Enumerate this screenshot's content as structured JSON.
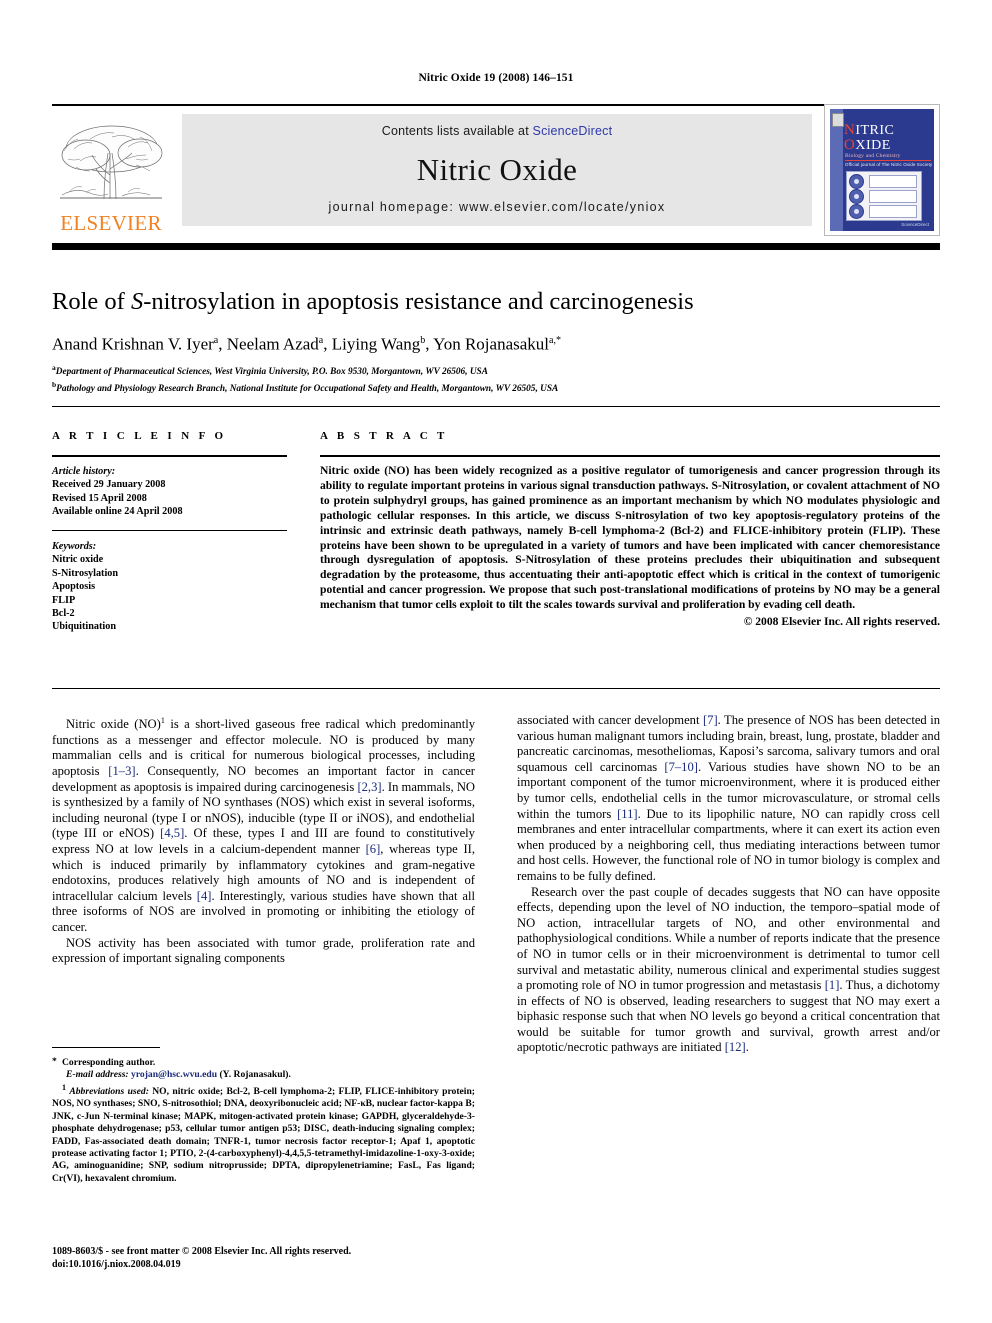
{
  "running_head": "Nitric Oxide 19 (2008) 146–151",
  "masthead": {
    "publisher_logo_text": "ELSEVIER",
    "contents_prefix": "Contents lists available at ",
    "contents_link": "ScienceDirect",
    "journal_name": "Nitric Oxide",
    "homepage": "journal homepage: www.elsevier.com/locate/yniox",
    "cover": {
      "line1": "N",
      "line1_rest": "ITRIC",
      "line2": "O",
      "line2_rest": "XIDE",
      "subtitle": "Biology and Chemistry",
      "society": "Official journal of The Nitric Oxide Society",
      "footer": "ScienceDirect"
    },
    "link_color": "#2d38a8"
  },
  "article": {
    "title_pre": "Role of ",
    "title_italic": "S",
    "title_post": "-nitrosylation in apoptosis resistance and carcinogenesis",
    "authors": [
      {
        "name": "Anand Krishnan V. Iyer",
        "sup": "a"
      },
      {
        "name": "Neelam Azad",
        "sup": "a"
      },
      {
        "name": "Liying Wang",
        "sup": "b"
      },
      {
        "name": "Yon Rojanasakul",
        "sup": "a,*"
      }
    ],
    "affiliations": [
      {
        "mark": "a",
        "text": "Department of Pharmaceutical Sciences, West Virginia University, P.O. Box 9530, Morgantown, WV 26506, USA"
      },
      {
        "mark": "b",
        "text": "Pathology and Physiology Research Branch, National Institute for Occupational Safety and Health, Morgantown, WV 26505, USA"
      }
    ]
  },
  "article_info": {
    "heading": "A R T I C L E    I N F O",
    "history_label": "Article history:",
    "history": [
      "Received 29 January 2008",
      "Revised 15 April 2008",
      "Available online 24 April 2008"
    ],
    "keywords_label": "Keywords:",
    "keywords": [
      "Nitric oxide",
      "S-Nitrosylation",
      "Apoptosis",
      "FLIP",
      "Bcl-2",
      "Ubiquitination"
    ]
  },
  "abstract": {
    "heading": "A B S T R A C T",
    "text": "Nitric oxide (NO) has been widely recognized as a positive regulator of tumorigenesis and cancer progression through its ability to regulate important proteins in various signal transduction pathways. S-Nitrosylation, or covalent attachment of NO to protein sulphydryl groups, has gained prominence as an important mechanism by which NO modulates physiologic and pathologic cellular responses. In this article, we discuss S-nitrosylation of two key apoptosis-regulatory proteins of the intrinsic and extrinsic death pathways, namely B-cell lymphoma-2 (Bcl-2) and FLICE-inhibitory protein (FLIP). These proteins have been shown to be upregulated in a variety of tumors and have been implicated with cancer chemoresistance through dysregulation of apoptosis. S-Nitrosylation of these proteins precludes their ubiquitination and subsequent degradation by the proteasome, thus accentuating their anti-apoptotic effect which is critical in the context of tumorigenic potential and cancer progression. We propose that such post-translational modifications of proteins by NO may be a general mechanism that tumor cells exploit to tilt the scales towards survival and proliferation by evading cell death.",
    "copyright": "© 2008 Elsevier Inc. All rights reserved."
  },
  "body": {
    "left": [
      {
        "indent": true,
        "segments": [
          {
            "t": "Nitric oxide (NO)"
          },
          {
            "t": "1",
            "style": "sup"
          },
          {
            "t": " is a short-lived gaseous free radical which predominantly functions as a messenger and effector molecule. NO is produced by many mammalian cells and is critical for numerous biological processes, including apoptosis "
          },
          {
            "t": "[1–3]",
            "style": "ref"
          },
          {
            "t": ". Consequently, NO becomes an important factor in cancer development as apoptosis is impaired during carcinogenesis "
          },
          {
            "t": "[2,3]",
            "style": "ref"
          },
          {
            "t": ". In mammals, NO is synthesized by a family of NO synthases (NOS) which exist in several isoforms, including neuronal (type I or nNOS), inducible (type II or iNOS), and endothelial (type III or eNOS) "
          },
          {
            "t": "[4,5]",
            "style": "ref"
          },
          {
            "t": ". Of these, types I and III are found to constitutively express NO at low levels in a calcium-dependent manner "
          },
          {
            "t": "[6]",
            "style": "ref"
          },
          {
            "t": ", whereas type II, which is induced primarily by inflammatory cytokines and gram-negative endotoxins, produces relatively high amounts of NO and is independent of intracellular calcium levels "
          },
          {
            "t": "[4]",
            "style": "ref"
          },
          {
            "t": ". Interestingly, various studies have shown that all three isoforms of NOS are involved in promoting or inhibiting the etiology of cancer."
          }
        ]
      },
      {
        "indent": true,
        "segments": [
          {
            "t": "NOS activity has been associated with tumor grade, proliferation rate and expression of important signaling components"
          }
        ]
      }
    ],
    "right": [
      {
        "indent": false,
        "segments": [
          {
            "t": "associated with cancer development "
          },
          {
            "t": "[7]",
            "style": "ref"
          },
          {
            "t": ". The presence of NOS has been detected in various human malignant tumors including brain, breast, lung, prostate, bladder and pancreatic carcinomas, mesotheliomas, Kaposi’s sarcoma, salivary tumors and oral squamous cell carcinomas "
          },
          {
            "t": "[7–10]",
            "style": "ref"
          },
          {
            "t": ". Various studies have shown NO to be an important component of the tumor microenvironment, where it is produced either by tumor cells, endothelial cells in the tumor microvasculature, or stromal cells within the tumors "
          },
          {
            "t": "[11]",
            "style": "ref"
          },
          {
            "t": ". Due to its lipophilic nature, NO can rapidly cross cell membranes and enter intracellular compartments, where it can exert its action even when produced by a neighboring cell, thus mediating interactions between tumor and host cells. However, the functional role of NO in tumor biology is complex and remains to be fully defined."
          }
        ]
      },
      {
        "indent": true,
        "segments": [
          {
            "t": "Research over the past couple of decades suggests that NO can have opposite effects, depending upon the level of NO induction, the temporo–spatial mode of NO action, intracellular targets of NO, and other environmental and pathophysiological conditions. While a number of reports indicate that the presence of NO in tumor cells or in their microenvironment is detrimental to tumor cell survival and metastatic ability, numerous clinical and experimental studies suggest a promoting role of NO in tumor progression and metastasis "
          },
          {
            "t": "[1]",
            "style": "ref"
          },
          {
            "t": ". Thus, a dichotomy in effects of NO is observed, leading researchers to suggest that NO may exert a biphasic response such that when NO levels go beyond a critical concentration that would be suitable for tumor growth and survival, growth arrest and/or apoptotic/necrotic pathways are initiated "
          },
          {
            "t": "[12]",
            "style": "ref"
          },
          {
            "t": "."
          }
        ]
      }
    ]
  },
  "footnotes": {
    "corresponding_mark": "*",
    "corresponding": "Corresponding author.",
    "email_label": "E-mail address:",
    "email": "yrojan@hsc.wvu.edu",
    "email_suffix": " (Y. Rojanasakul).",
    "abbrev_mark": "1",
    "abbrev_label": "Abbreviations used:",
    "abbrev_text": " NO, nitric oxide; Bcl-2, B-cell lymphoma-2; FLIP, FLICE-inhibitory protein; NOS, NO synthases; SNO, S-nitrosothiol; DNA, deoxyribonucleic acid; NF-κB, nuclear factor-kappa B; JNK, c-Jun N-terminal kinase; MAPK, mitogen-activated protein kinase; GAPDH, glyceraldehyde-3-phosphate dehydrogenase; p53, cellular tumor antigen p53; DISC, death-inducing signaling complex; FADD, Fas-associated death domain; TNFR-1, tumor necrosis factor receptor-1; Apaf 1, apoptotic protease activating factor 1; PTIO, 2-(4-carboxyphenyl)-4,4,5,5-tetramethyl-imidazoline-1-oxy-3-oxide; AG, aminoguanidine; SNP, sodium nitroprusside; DPTA, dipropylenetriamine; FasL, Fas ligand; Cr(VI), hexavalent chromium."
  },
  "issn_line": "1089-8603/$ - see front matter © 2008 Elsevier Inc. All rights reserved.",
  "doi_line": "doi:10.1016/j.niox.2008.04.019"
}
